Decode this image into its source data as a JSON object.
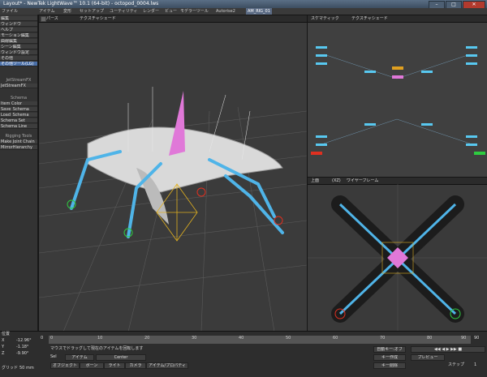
{
  "window": {
    "title": "Layout* - NewTek LightWave™ 10.1 (64-bit) - octopod_0004.lws",
    "minimize": "–",
    "maximize": "□",
    "close": "✕"
  },
  "menubar": {
    "tabs": [
      "ファイル",
      "アイテム",
      "変形",
      "セットアップ",
      "ユーティリティ",
      "レンダー",
      "ビュー",
      "モデラーツール",
      "Autorise2",
      "AM_RIG_01"
    ],
    "active_index": 9
  },
  "left_panel": {
    "items": [
      "編集",
      "ウィンドウ",
      "ヘルプ",
      "モーション編集",
      "曲線編集",
      "シーン編集",
      "ウィンドウ設定",
      "その他",
      "その他ツール",
      "その他"
    ],
    "highlight_label": "その他ツール(LG)",
    "group_head": "JetStreamFX",
    "group_item": "JetStreamFX",
    "schema_head": "Schema",
    "schema_items": [
      "Item Color",
      "Save_Schema",
      "Load_Schema",
      "Schema Set",
      "Schema Line"
    ],
    "rigging_head": "Rigging Tools",
    "rigging_items": [
      "Make Joint Chain",
      "MirrorHierarchy"
    ]
  },
  "viewports": {
    "main": {
      "view": "パース",
      "mode": "テクスチャシェード"
    },
    "schematic": {
      "view": "スケマティック",
      "mode": "テクスチャシェード"
    },
    "top": {
      "view": "上面",
      "axis": "(XZ)",
      "mode": "ワイヤーフレーム"
    }
  },
  "bottom": {
    "coord_labels": [
      "X",
      "Y",
      "Z"
    ],
    "coord_values": [
      "-12.96°",
      "-1.18°",
      "-9.90°"
    ],
    "unit_label": "位置",
    "grid_label": "グリッド",
    "grid_value": "50 mm",
    "status": "マウスでドラッグして現在のアイテムを回転します",
    "item_label": "Sel",
    "item_type": "アイテム",
    "item_name": "Center",
    "current_frame": "0",
    "timeline_ticks": [
      "0",
      "10",
      "20",
      "30",
      "40",
      "50",
      "60",
      "70",
      "80",
      "90"
    ],
    "end_frame": "90",
    "buttons": [
      "オブジェクト",
      "ボーン",
      "ライト",
      "カメラ",
      "アイテム/プロパティ"
    ],
    "right_buttons": [
      "自動キー:オフ",
      "キー作成",
      "キー削除"
    ],
    "preview_label": "プレビュー",
    "step_label": "ステップ",
    "step_value": "1"
  }
}
